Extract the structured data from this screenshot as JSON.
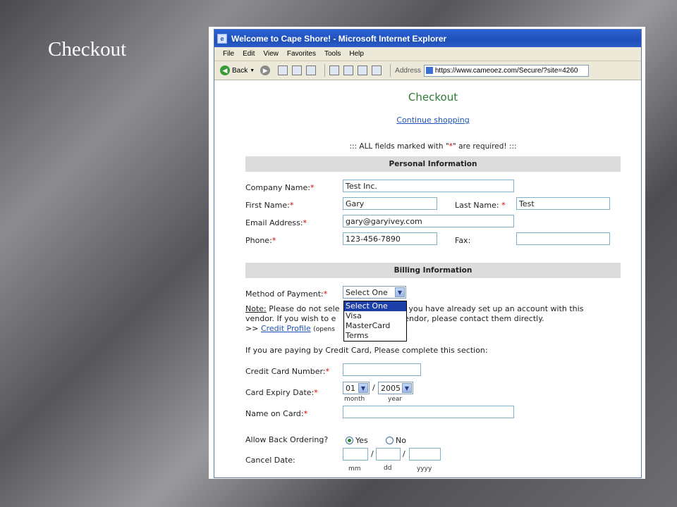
{
  "slide": {
    "title": "Checkout"
  },
  "window": {
    "title": "Welcome to Cape Shore! - Microsoft Internet Explorer",
    "menu": [
      "File",
      "Edit",
      "View",
      "Favorites",
      "Tools",
      "Help"
    ],
    "toolbar": {
      "back_label": "Back",
      "address_label": "Address",
      "address_value": "https://www.cameoez.com/Secure/?site=4260"
    }
  },
  "page": {
    "title": "Checkout",
    "continue_link": "Continue shopping",
    "required_note_prefix": "::: ALL fields marked with \"",
    "required_star": "*",
    "required_note_suffix": "\" are required! :::",
    "personal": {
      "header": "Personal Information",
      "company_label": "Company Name:",
      "company_value": "Test Inc.",
      "first_label": "First Name:",
      "first_value": "Gary",
      "last_label": "Last Name:",
      "last_value": "Test",
      "email_label": "Email Address:",
      "email_value": "gary@garyivey.com",
      "phone_label": "Phone:",
      "phone_value": "123-456-7890",
      "fax_label": "Fax:",
      "fax_value": ""
    },
    "billing": {
      "header": "Billing Information",
      "payment_label": "Method of Payment:",
      "payment_selected": "Select One",
      "payment_options": [
        "Select One",
        "Visa",
        "MasterCard",
        "Terms"
      ],
      "note_label": "Note:",
      "note_line1_a": "Please do not sele",
      "note_line1_b": "ss you have already set up an account with this",
      "note_line2_a": "vendor. If you wish to e",
      "note_line2_b": "with this vendor, please contact them directly.",
      "note_line3_prefix": ">> ",
      "credit_profile_link": "Credit Profile",
      "opens_text": "(opens",
      "credit_section_note": "If you are paying by Credit Card, Please complete this section:",
      "cc_number_label": "Credit Card Number:",
      "cc_number_value": "",
      "expiry_label": "Card Expiry Date:",
      "expiry_month": "01",
      "expiry_year": "2005",
      "expiry_slash": "/",
      "month_caption": "month",
      "year_caption": "year",
      "name_label": "Name on Card:",
      "name_value": "",
      "backorder_label": "Allow Back Ordering?",
      "yes_label": "Yes",
      "no_label": "No",
      "backorder_selected": "Yes",
      "cancel_label": "Cancel Date:",
      "mm_caption": "mm",
      "dd_caption": "dd",
      "yyyy_caption": "yyyy",
      "date_slash": "/"
    }
  }
}
